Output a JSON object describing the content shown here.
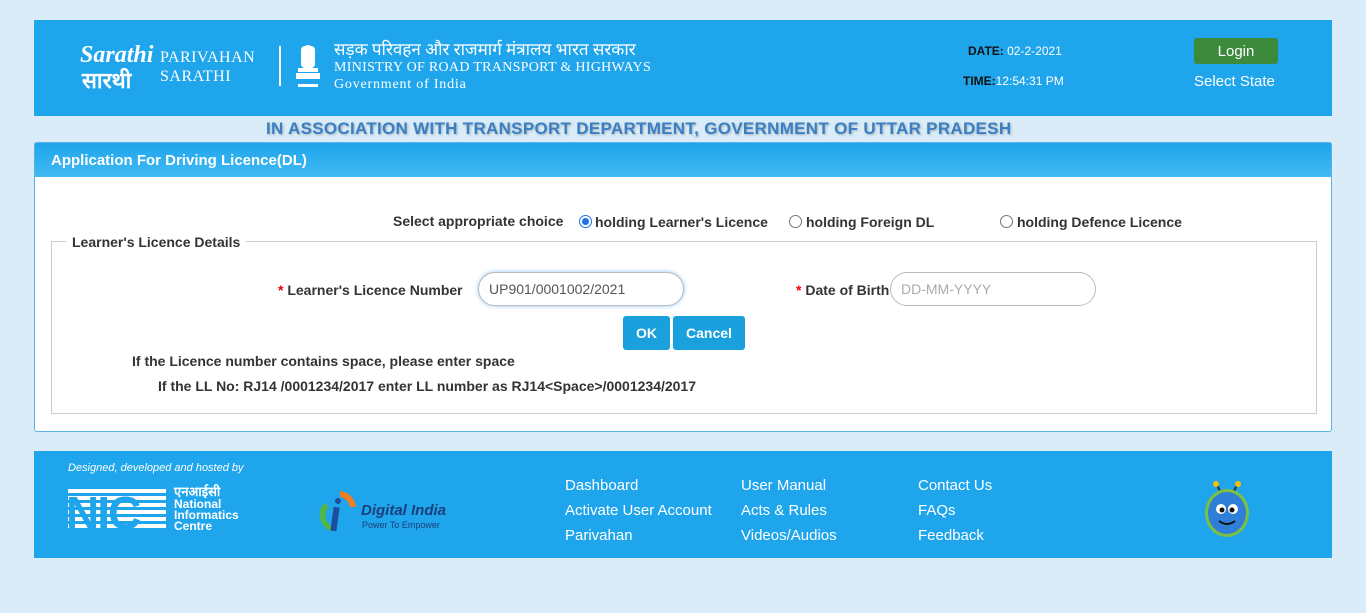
{
  "header": {
    "brand_line1": "PARIVAHAN",
    "brand_line2": "SARATHI",
    "ministry_hindi": "सड़क परिवहन और राजमार्ग मंत्रालय भारत सरकार",
    "ministry_english": "MINISTRY OF ROAD TRANSPORT & HIGHWAYS",
    "government": "Government of India",
    "date_label": "DATE:",
    "date_value": "02-2-2021",
    "time_label": "TIME:",
    "time_value": "12:54:31 PM",
    "login_label": "Login",
    "select_state_label": "Select State"
  },
  "association_text": "IN ASSOCIATION WITH TRANSPORT DEPARTMENT, GOVERNMENT OF UTTAR PRADESH",
  "panel": {
    "title": "Application For Driving Licence(DL)",
    "choice_label": "Select appropriate choice",
    "choices": [
      {
        "label": "holding Learner's Licence",
        "selected": true
      },
      {
        "label": "holding Foreign DL",
        "selected": false
      },
      {
        "label": "holding Defence Licence",
        "selected": false
      }
    ],
    "fieldset_legend": "Learner's Licence Details",
    "required_mark": "*",
    "ll_number_label": "Learner's Licence Number",
    "ll_number_value": "UP901/0001002/2021",
    "dob_label": "Date of Birth",
    "dob_placeholder": "DD-MM-YYYY",
    "ok_label": "OK",
    "cancel_label": "Cancel",
    "note1": "If the Licence number contains space, please enter space",
    "note2": "If the LL No: RJ14 /0001234/2017 enter LL number as RJ14<Space>/0001234/2017"
  },
  "footer": {
    "designed_by": "Designed, developed and hosted by",
    "nic_hindi": "एनआईसी",
    "nic_line1": "National",
    "nic_line2": "Informatics",
    "nic_line3": "Centre",
    "nic_mark": "NIC",
    "digital_india_title": "Digital India",
    "digital_india_tagline": "Power To Empower",
    "links_col1": [
      "Dashboard",
      "Activate User Account",
      "Parivahan"
    ],
    "links_col2": [
      "User Manual",
      "Acts & Rules",
      "Videos/Audios"
    ],
    "links_col3": [
      "Contact Us",
      "FAQs",
      "Feedback"
    ]
  }
}
